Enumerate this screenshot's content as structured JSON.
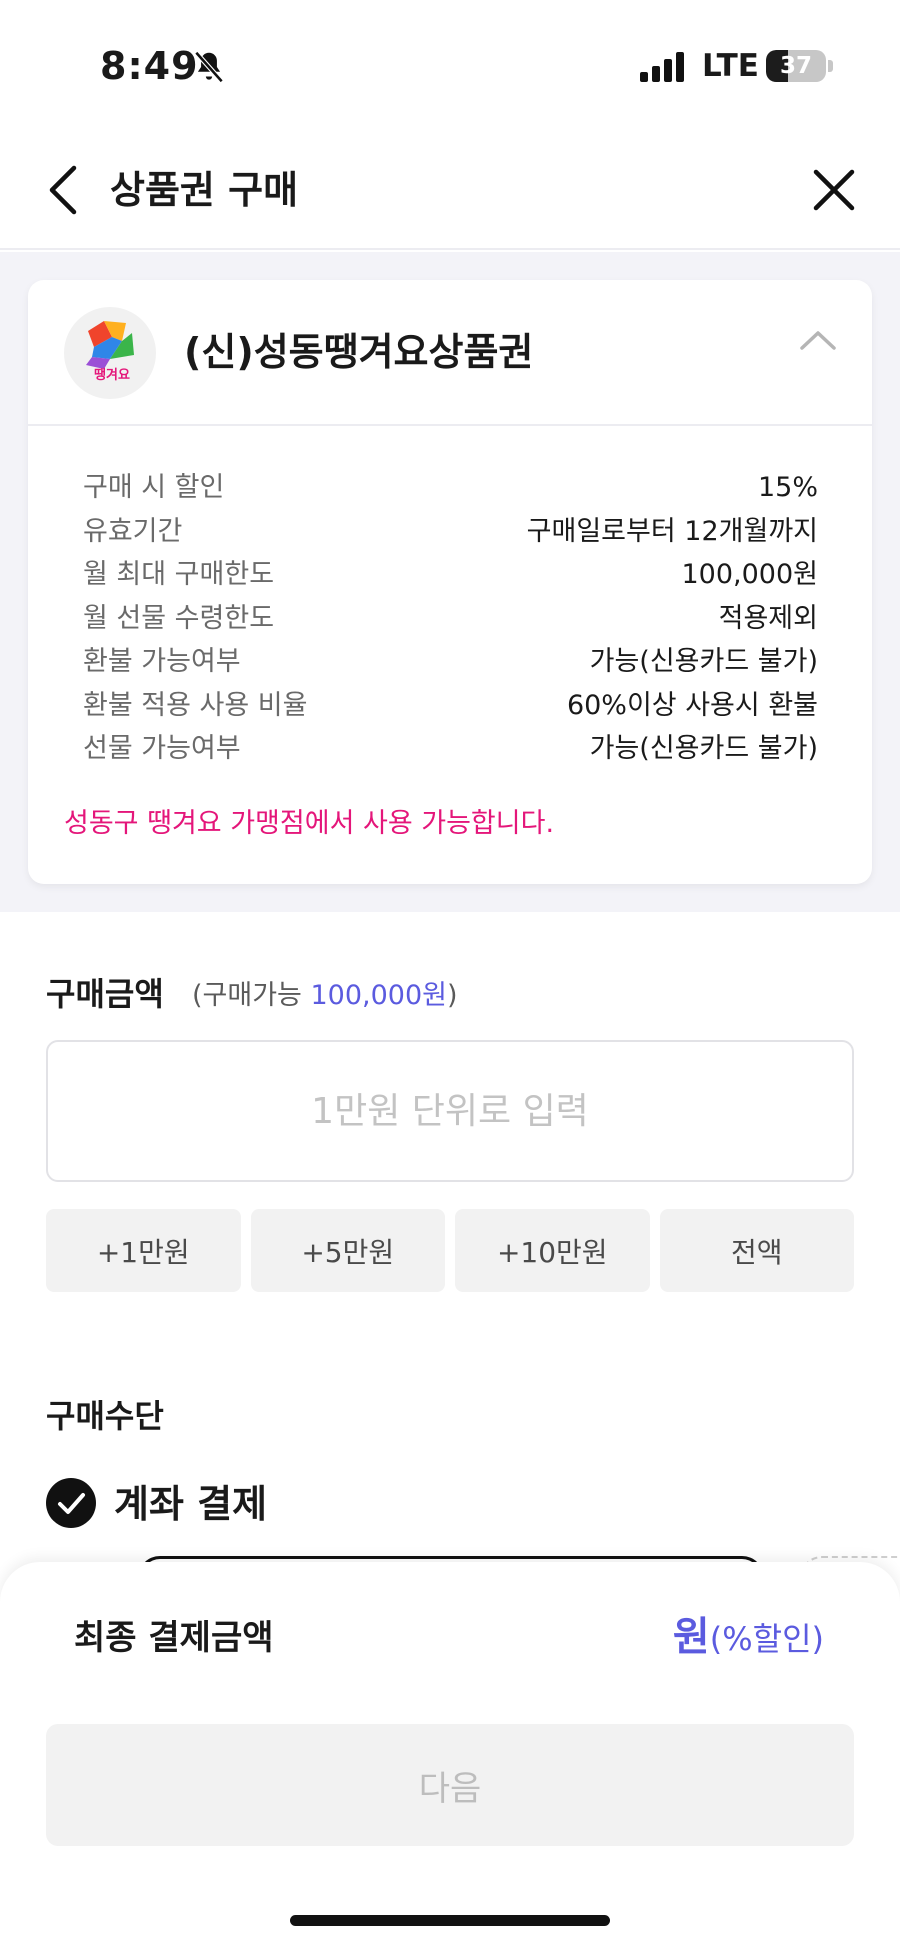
{
  "status_bar": {
    "time": "8:49",
    "network": "LTE",
    "battery_label": "37",
    "battery_level": 0.37
  },
  "header": {
    "title": "상품권 구매",
    "back_icon": "chevron-left-icon",
    "close_icon": "close-icon"
  },
  "voucher": {
    "name": "(신)성동땡겨요상품권",
    "logo_text": "땡겨요",
    "details": [
      {
        "label": "구매 시 할인",
        "value": "15%"
      },
      {
        "label": "유효기간",
        "value": "구매일로부터 12개월까지"
      },
      {
        "label": "월 최대 구매한도",
        "value": "100,000원"
      },
      {
        "label": "월 선물 수령한도",
        "value": "적용제외"
      },
      {
        "label": "환불 가능여부",
        "value": "가능(신용카드 불가)"
      },
      {
        "label": "환불 적용 사용 비율",
        "value": "60%이상 사용시 환불"
      },
      {
        "label": "선물 가능여부",
        "value": "가능(신용카드 불가)"
      }
    ],
    "usage_note": "성동구 땡겨요 가맹점에서 사용 가능합니다."
  },
  "purchase": {
    "title": "구매금액",
    "available_prefix": "(구매가능 ",
    "available_amount": "100,000원",
    "available_suffix": ")",
    "input_placeholder": "1만원 단위로 입력",
    "input_value": "",
    "quick_buttons": [
      "+1만원",
      "+5만원",
      "+10만원",
      "전액"
    ]
  },
  "method": {
    "title": "구매수단",
    "selected_label": "계좌 결제"
  },
  "summary": {
    "label": "최종 결제금액",
    "unit": "원",
    "discount": "(%할인)",
    "next_label": "다음"
  },
  "colors": {
    "accent": "#5b5bdf",
    "notice": "#e4167a",
    "muted_bg": "#f3f3f8"
  }
}
